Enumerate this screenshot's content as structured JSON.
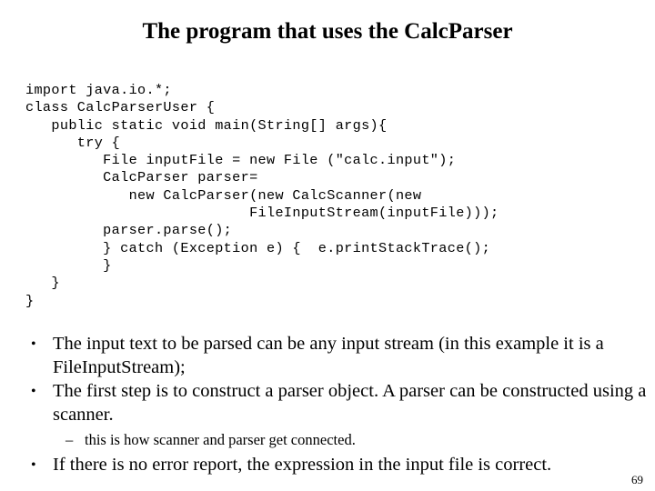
{
  "slide": {
    "title": "The program that uses the CalcParser",
    "page_number": "69"
  },
  "code": {
    "language": "java",
    "lines": [
      "import java.io.*;",
      "class CalcParserUser {",
      "   public static void main(String[] args){",
      "      try {",
      "         File inputFile = new File (\"calc.input\");",
      "         CalcParser parser=",
      "            new CalcParser(new CalcScanner(new",
      "                          FileInputStream(inputFile)));",
      "         parser.parse();",
      "         } catch (Exception e) {  e.printStackTrace();",
      "         }",
      "   }",
      "}"
    ]
  },
  "bullets": [
    {
      "level": 1,
      "marker": "•",
      "text": "The input text to be parsed can be any input stream (in this example it is a FileInputStream);"
    },
    {
      "level": 1,
      "marker": "•",
      "text": "The first step is to construct a parser object. A parser can be constructed using a scanner."
    },
    {
      "level": 2,
      "marker": "–",
      "text": "this is how scanner and parser get connected."
    },
    {
      "level": 1,
      "marker": "•",
      "text": "If there is no error report, the expression in the input file is correct."
    }
  ]
}
